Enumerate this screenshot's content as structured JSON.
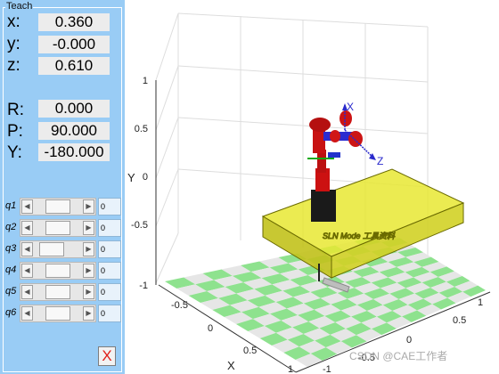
{
  "teach": {
    "title": "Teach",
    "position": [
      {
        "label": "x:",
        "value": "0.360"
      },
      {
        "label": "y:",
        "value": "-0.000"
      },
      {
        "label": "z:",
        "value": "0.610"
      }
    ],
    "orientation": [
      {
        "label": "R:",
        "value": "0.000"
      },
      {
        "label": "P:",
        "value": "90.000"
      },
      {
        "label": "Y:",
        "value": "-180.000"
      }
    ],
    "joints": [
      {
        "label": "q1",
        "value": "0",
        "level": 0.5
      },
      {
        "label": "q2",
        "value": "0",
        "level": 0.5
      },
      {
        "label": "q3",
        "value": "0",
        "level": 0.25
      },
      {
        "label": "q4",
        "value": "0",
        "level": 0.5
      },
      {
        "label": "q5",
        "value": "0",
        "level": 0.5
      },
      {
        "label": "q6",
        "value": "0",
        "level": 0.5
      }
    ],
    "close_label": "X"
  },
  "axes": {
    "z_ticks": [
      "1",
      "0.5",
      "0",
      "-0.5",
      "-1"
    ],
    "x_ticks": [
      "-0.5",
      "0",
      "0.5",
      "1"
    ],
    "y_ticks": [
      "-1",
      "-0.5",
      "0",
      "0.5",
      "1"
    ],
    "x_label": "X",
    "z_label": "Y"
  },
  "scene": {
    "frame_labels": {
      "x": "X",
      "z": "Z"
    },
    "table_text": "SLN Mode 工具资料",
    "colors": {
      "checker_green": "#8ee28e",
      "checker_light": "#e6e6e6",
      "table_yellow": "#e3e32e",
      "robot_red": "#c81414",
      "robot_blue": "#1a2fcc"
    }
  },
  "watermark": "CSDN @CAE工作者"
}
